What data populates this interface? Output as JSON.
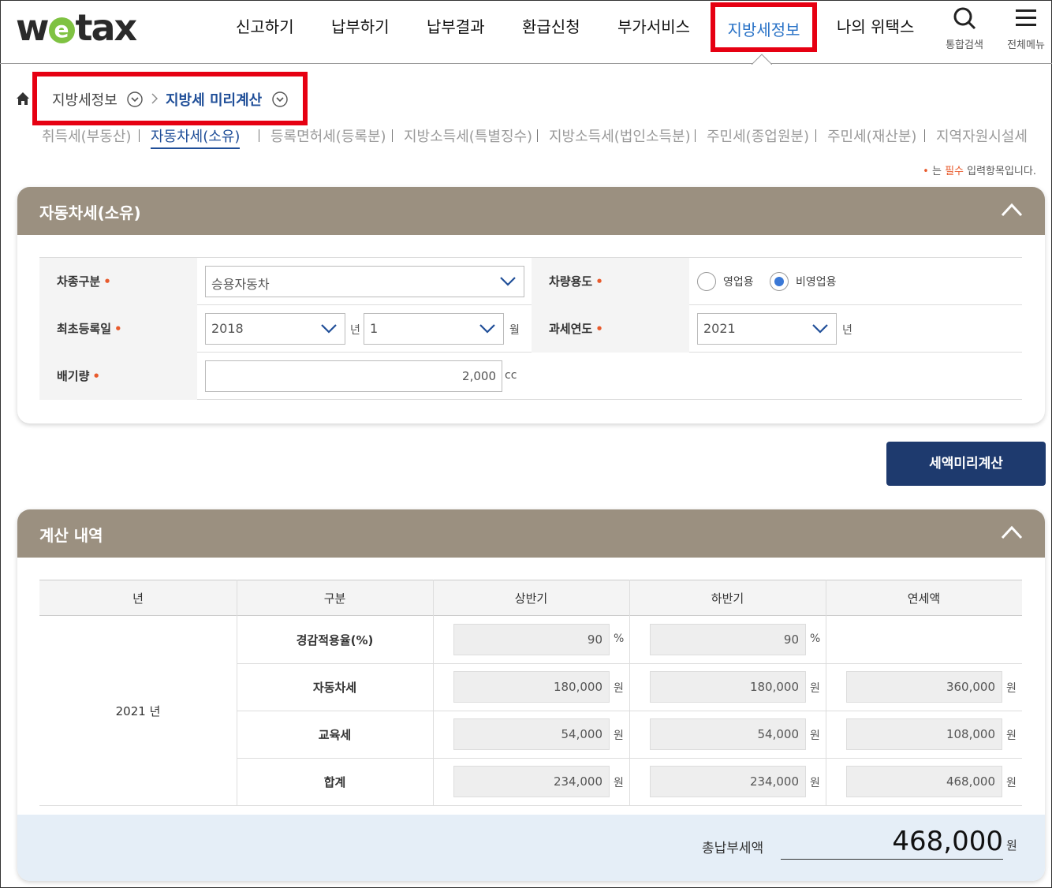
{
  "logo": {
    "pre": "w",
    "mid": "e",
    "post": "tax"
  },
  "nav": {
    "items": [
      "신고하기",
      "납부하기",
      "납부결과",
      "환급신청",
      "부가서비스"
    ],
    "active": "지방세정보",
    "last": "나의 위택스",
    "search_label": "통합검색",
    "menu_label": "전체메뉴"
  },
  "breadcrumb": {
    "level1": "지방세정보",
    "level2": "지방세 미리계산"
  },
  "subtabs": [
    "취득세(부동산)",
    "자동차세(소유)",
    "등록면허세(등록분)",
    "지방소득세(특별징수)",
    "지방소득세(법인소득분)",
    "주민세(종업원분)",
    "주민세(재산분)",
    "지역자원시설세"
  ],
  "required_note": {
    "dot": "•",
    "pre": " 는 ",
    "red": "필수",
    "post": " 입력항목입니다."
  },
  "form_panel": {
    "title": "자동차세(소유)",
    "car_type_label": "차종구분",
    "car_type_value": "승용자동차",
    "usage_label": "차량용도",
    "usage_opt1": "영업용",
    "usage_opt2": "비영업용",
    "reg_label": "최초등록일",
    "reg_year": "2018",
    "reg_year_unit": "년",
    "reg_month": "1",
    "reg_month_unit": "월",
    "tax_year_label": "과세연도",
    "tax_year": "2021",
    "tax_year_unit": "년",
    "cc_label": "배기량",
    "cc_value": "2,000",
    "cc_unit": "cc"
  },
  "calc_button": "세액미리계산",
  "result_panel": {
    "title": "계산 내역",
    "headers": [
      "년",
      "구분",
      "상반기",
      "하반기",
      "연세액"
    ],
    "year": "2021 년",
    "rows": [
      {
        "label": "경감적용율(%)",
        "first": "90",
        "second": "90",
        "annual": "",
        "unit": "%"
      },
      {
        "label": "자동차세",
        "first": "180,000",
        "second": "180,000",
        "annual": "360,000",
        "unit": "원"
      },
      {
        "label": "교육세",
        "first": "54,000",
        "second": "54,000",
        "annual": "108,000",
        "unit": "원"
      },
      {
        "label": "합계",
        "first": "234,000",
        "second": "234,000",
        "annual": "468,000",
        "unit": "원"
      }
    ],
    "total_label": "총납부세액",
    "total_value": "468,000",
    "total_unit": "원"
  }
}
